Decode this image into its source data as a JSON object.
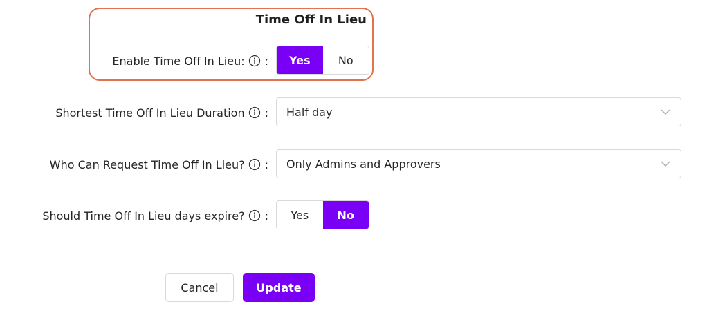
{
  "section": {
    "title": "Time Off In Lieu"
  },
  "fields": {
    "enable": {
      "label": "Enable Time Off In Lieu:",
      "colon": ":",
      "options": [
        "Yes",
        "No"
      ],
      "selected": "Yes"
    },
    "shortest_duration": {
      "label": "Shortest Time Off In Lieu Duration",
      "colon": ":",
      "value": "Half day"
    },
    "who_can_request": {
      "label": "Who Can Request Time Off In Lieu?",
      "colon": ":",
      "value": "Only Admins and Approvers"
    },
    "days_expire": {
      "label": "Should Time Off In Lieu days expire?",
      "colon": ":",
      "options": [
        "Yes",
        "No"
      ],
      "selected": "No"
    }
  },
  "actions": {
    "cancel_label": "Cancel",
    "update_label": "Update"
  },
  "icons": {
    "info": "info-circle-icon",
    "dropdown": "chevron-down-icon"
  },
  "colors": {
    "accent": "#7a00f5",
    "highlight_border": "#e2734f"
  }
}
